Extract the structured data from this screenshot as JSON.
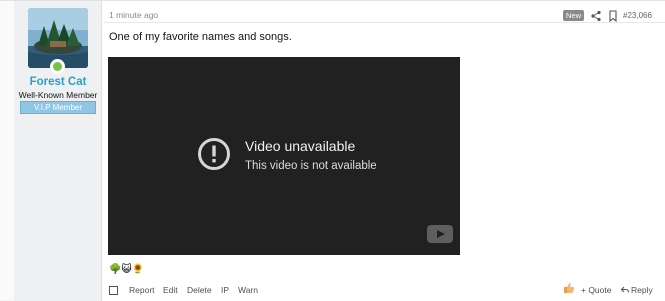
{
  "user": {
    "name": "Forest Cat",
    "title": "Well-Known Member",
    "banner": "V.I.P Member"
  },
  "post": {
    "time": "1 minute ago",
    "new_badge": "New",
    "number": "#23,066",
    "message": "One of my favorite names and songs."
  },
  "video": {
    "title": "Video unavailable",
    "subtitle": "This video is not available"
  },
  "emojis": [
    "🌳",
    "😺",
    "🌻"
  ],
  "actions": {
    "report": "Report",
    "edit": "Edit",
    "delete": "Delete",
    "ip": "IP",
    "warn": "Warn",
    "quote": "+ Quote",
    "reply": "Reply"
  },
  "colors": {
    "username": "#2aa0c8",
    "banner_bg": "#8fc6e6",
    "video_bg": "#212121",
    "online": "#7ac142"
  }
}
